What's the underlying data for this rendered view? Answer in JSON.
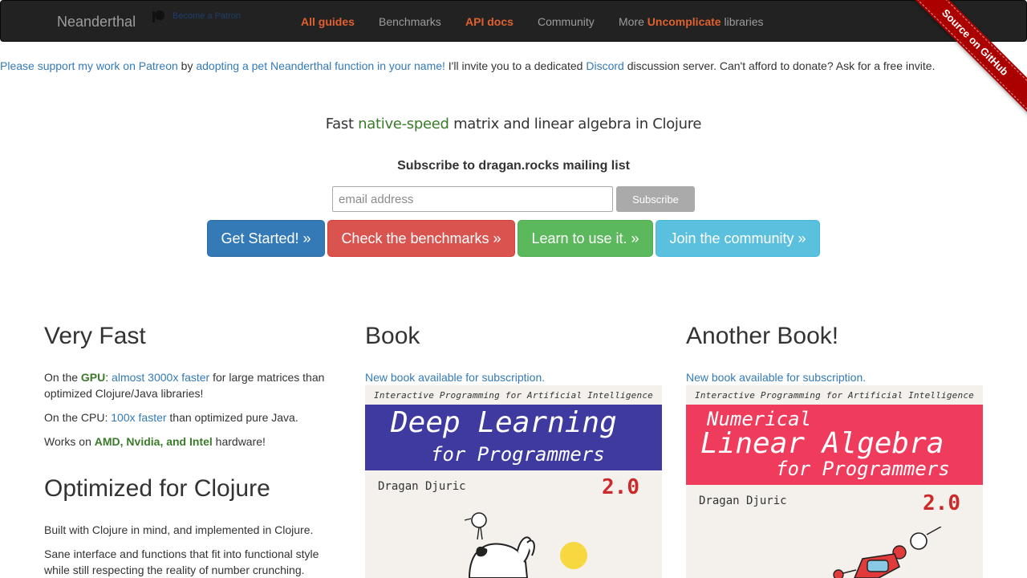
{
  "nav": {
    "brand": "Neanderthal",
    "patreon_label": "Become a Patron",
    "items": [
      {
        "label": "All guides",
        "highlight": true
      },
      {
        "label": "Benchmarks",
        "highlight": false
      },
      {
        "label": "API docs",
        "highlight": true
      },
      {
        "label": "Community",
        "highlight": false
      }
    ],
    "more": {
      "prefix": "More ",
      "highlight": "Uncomplicate",
      "suffix": " libraries"
    }
  },
  "ribbon": "Source on GitHub",
  "support": {
    "link1": "Please support my work on Patreon",
    "text1": " by ",
    "link2": "adopting a pet Neanderthal function in your name!",
    "text2": " I'll invite you to a dedicated ",
    "link3": "Discord",
    "text3": " discussion server. Can't afford to donate? Ask for a free invite."
  },
  "tagline": {
    "pre": "Fast ",
    "green": "native-speed",
    "post": " matrix and linear algebra in Clojure"
  },
  "subscribe": {
    "title": "Subscribe to dragan.rocks mailing list",
    "placeholder": "email address",
    "button": "Subscribe"
  },
  "cta": {
    "get_started": "Get Started! »",
    "benchmarks": "Check the benchmarks »",
    "learn": "Learn to use it. »",
    "community": "Join the community »"
  },
  "col1": {
    "title": "Very Fast",
    "p1": {
      "a": "On the ",
      "b": "GPU",
      "c": ": ",
      "link": "almost 3000x faster",
      "d": " for large matrices than optimized Clojure/Java libraries!"
    },
    "p2": {
      "a": "On the CPU: ",
      "link": "100x faster",
      "b": " than optimized pure Java."
    },
    "p3": {
      "a": "Works on ",
      "b": "AMD, Nvidia, and Intel",
      "c": " hardware!"
    },
    "title2": "Optimized for Clojure",
    "p4": "Built with Clojure in mind, and implemented in Clojure.",
    "p5": "Sane interface and functions that fit into functional style while still respecting the reality of number crunching."
  },
  "col2": {
    "title": "Book",
    "link": "New book available for subscription.",
    "cover": {
      "series": "Interactive Programming for Artificial Intelligence",
      "line1": "Deep Learning",
      "line2": "for Programmers",
      "author": "Dragan Djuric",
      "version": "2.0",
      "band_color": "#3f3aa0"
    }
  },
  "col3": {
    "title": "Another Book!",
    "link": "New book available for subscription.",
    "cover": {
      "series": "Interactive Programming for Artificial Intelligence",
      "line0": "Numerical",
      "line1": "Linear Algebra",
      "line2": "for Programmers",
      "author": "Dragan Djuric",
      "version": "2.0",
      "band_color": "#ef3b5c"
    }
  },
  "colors": {
    "navbar": "#222222",
    "accent": "#e0602f",
    "link": "#337ab7",
    "green": "#3a7a2a"
  }
}
